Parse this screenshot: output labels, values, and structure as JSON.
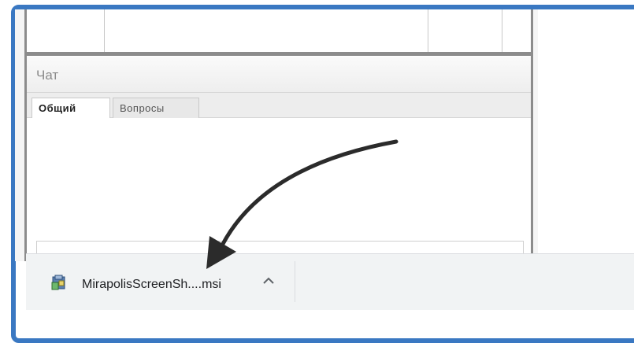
{
  "chat": {
    "title": "Чат",
    "tabs": [
      {
        "label": "Общий",
        "active": true
      },
      {
        "label": "Вопросы",
        "active": false
      }
    ]
  },
  "download_bar": {
    "file_name": "MirapolisScreenSh....msi",
    "file_icon": "installer-icon",
    "expand_icon": "chevron-up-icon"
  },
  "annotation": {
    "arrow": "curved-arrow-icon"
  },
  "colors": {
    "frame_border": "#3a78c2",
    "panel_border": "#8c8c8c",
    "download_bar_bg": "#f1f3f4"
  }
}
